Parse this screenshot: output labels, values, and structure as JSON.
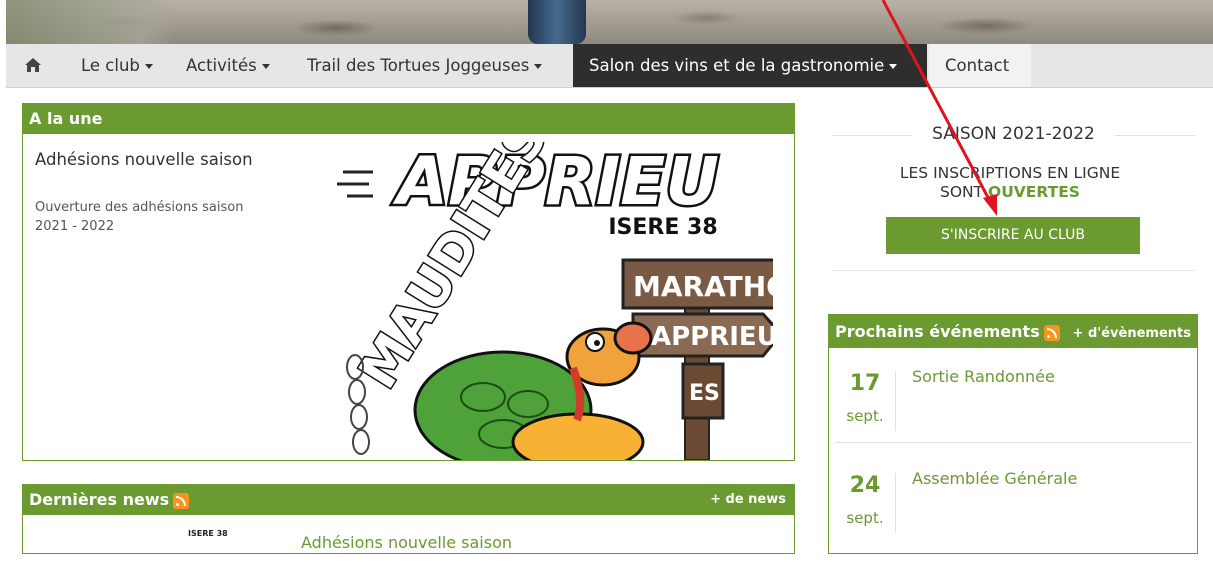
{
  "nav": {
    "items": [
      {
        "label": "Le club",
        "dropdown": true
      },
      {
        "label": "Activités",
        "dropdown": true
      },
      {
        "label": "Trail des Tortues Joggeuses",
        "dropdown": true
      },
      {
        "label": "Salon des vins et de la gastronomie",
        "dropdown": true,
        "active": true
      },
      {
        "label": "Contact",
        "dropdown": false
      }
    ]
  },
  "a_la_une": {
    "heading": "A la une",
    "title": "Adhésions nouvelle saison",
    "description": "Ouverture des adhésions saison 2021 - 2022",
    "poster": {
      "name": "APPRIEU",
      "region": "ISERE 38",
      "sign1": "MARATHON",
      "sign2": "APPRIEU",
      "sign3": "ES",
      "curve": "MAUDITES"
    }
  },
  "saison": {
    "title": "SAISON 2021-2022",
    "text_before": "LES INSCRIPTIONS EN LIGNE SONT ",
    "text_highlight": "OUVERTES",
    "button": "S'INSCRIRE AU CLUB"
  },
  "events": {
    "heading": "Prochains événements",
    "more": "+ d'évènements",
    "items": [
      {
        "day": "17",
        "month": "sept.",
        "title": "Sortie Randonnée"
      },
      {
        "day": "24",
        "month": "sept.",
        "title": "Assemblée Générale"
      }
    ]
  },
  "news": {
    "heading": "Dernières news",
    "more": "+ de news",
    "thumb_label": "ISERE 38",
    "first_title": "Adhésions nouvelle saison"
  },
  "colors": {
    "accent": "#6a9a30",
    "nav_bg": "#e6e6e6",
    "nav_active": "#2e2e2e",
    "annotation_arrow": "#e0141c"
  },
  "icons": {
    "home": "home-icon",
    "caret": "caret-down-icon",
    "rss": "rss-icon"
  }
}
